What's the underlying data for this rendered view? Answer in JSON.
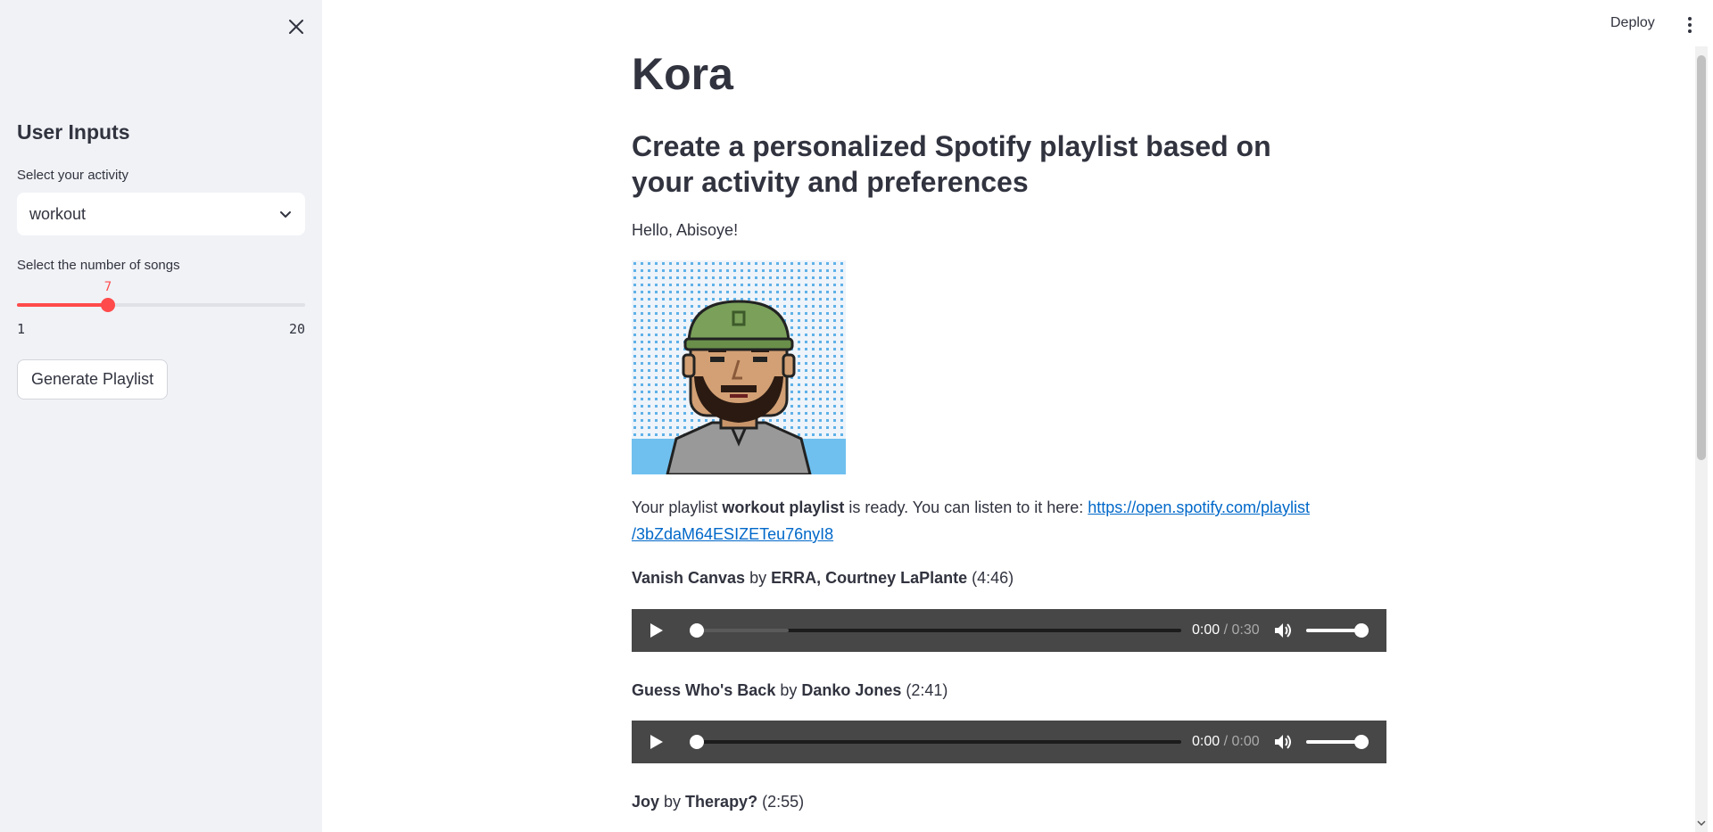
{
  "sidebar": {
    "title": "User Inputs",
    "activity_label": "Select your activity",
    "activity_value": "workout",
    "songs_label": "Select the number of songs",
    "songs_value": "7",
    "songs_value_num": 7,
    "songs_min": "1",
    "songs_max": "20",
    "generate_label": "Generate Playlist"
  },
  "header": {
    "deploy_label": "Deploy"
  },
  "main": {
    "title": "Kora",
    "subtitle": "Create a personalized Spotify playlist based on your activity and preferences",
    "greeting": "Hello, Abisoye!",
    "playlist_prefix": "Your playlist ",
    "playlist_name": "workout playlist",
    "playlist_suffix": " is ready. You can listen to it here: ",
    "playlist_url_line1": "https://open.spotify.com/playlist",
    "playlist_url_line2": "/3bZdaM64ESIZETeu76nyI8"
  },
  "tracks": [
    {
      "name": "Vanish Canvas",
      "by": " by ",
      "artist": "ERRA, Courtney LaPlante",
      "duration": " (4:46)",
      "current": "0:00",
      "total": " / 0:30",
      "buffered": 0.2
    },
    {
      "name": "Guess Who's Back",
      "by": " by ",
      "artist": "Danko Jones",
      "duration": " (2:41)",
      "current": "0:00",
      "total": " / 0:00",
      "buffered": 0
    },
    {
      "name": "Joy",
      "by": " by ",
      "artist": "Therapy?",
      "duration": " (2:55)"
    }
  ],
  "icons": {
    "close": "close-icon",
    "chevron": "chevron-down-icon",
    "play": "play-icon",
    "volume": "volume-icon",
    "menu": "kebab-menu-icon",
    "avatar": "pixel-avatar"
  },
  "colors": {
    "accent": "#ff4b4b",
    "link": "#0068c9",
    "sidebar_bg": "#f0f2f6",
    "player_bg": "#474747"
  }
}
